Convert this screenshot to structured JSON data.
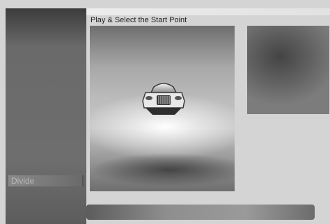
{
  "sidebar": {
    "items": [
      {
        "label": "Divide"
      }
    ]
  },
  "main": {
    "title": "Play & Select the Start Point"
  },
  "icons": {
    "preview_subject": "car-icon"
  }
}
